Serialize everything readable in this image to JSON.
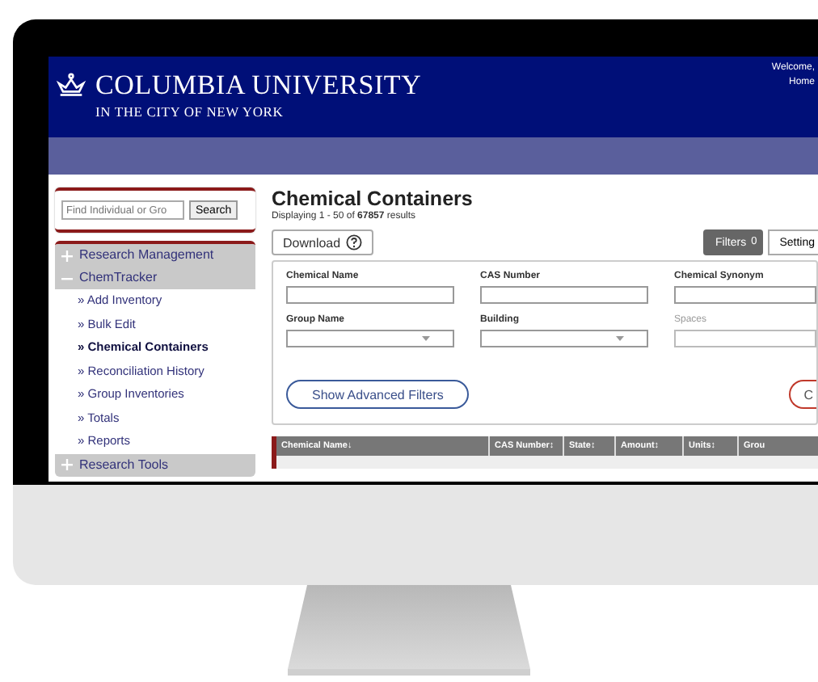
{
  "header": {
    "logo_title": "COLUMBIA UNIVERSITY",
    "logo_subtitle": "IN THE CITY OF NEW YORK",
    "welcome": "Welcome,",
    "home_link": "Home"
  },
  "sidebar": {
    "search": {
      "placeholder": "Find Individual or Gro",
      "button": "Search"
    },
    "menu": [
      {
        "label": "Research Management",
        "expanded": false
      },
      {
        "label": "ChemTracker",
        "expanded": true,
        "children": [
          {
            "label": "» Add Inventory",
            "selected": false
          },
          {
            "label": "» Bulk Edit",
            "selected": false
          },
          {
            "label": "» Chemical Containers",
            "selected": true
          },
          {
            "label": "» Reconciliation History",
            "selected": false
          },
          {
            "label": "» Group Inventories",
            "selected": false
          },
          {
            "label": "» Totals",
            "selected": false
          },
          {
            "label": "» Reports",
            "selected": false
          }
        ]
      },
      {
        "label": "Research Tools",
        "expanded": false
      }
    ]
  },
  "main": {
    "title": "Chemical Containers",
    "subtitle": "Displaying 1 - 50 of **67857** results",
    "download_button": "Download",
    "filters_button": "Filters",
    "filters_count": "0",
    "settings_button": "Setting",
    "filters": [
      {
        "label": "Chemical Name",
        "kind": "text",
        "disabled": false
      },
      {
        "label": "CAS Number",
        "kind": "text",
        "disabled": false
      },
      {
        "label": "Chemical Synonym",
        "kind": "text",
        "disabled": false
      },
      {
        "label": "Group Name",
        "kind": "select",
        "disabled": false
      },
      {
        "label": "Building",
        "kind": "select",
        "disabled": false
      },
      {
        "label": "Spaces",
        "kind": "text",
        "disabled": true
      }
    ],
    "advanced_button": "Show Advanced Filters",
    "clear_button": "C",
    "table": {
      "columns": [
        {
          "label": "Chemical Name",
          "sort": "↓"
        },
        {
          "label": "CAS Number",
          "sort": "↕"
        },
        {
          "label": "State",
          "sort": "↕"
        },
        {
          "label": "Amount",
          "sort": "↕"
        },
        {
          "label": "Units",
          "sort": "↕"
        },
        {
          "label": "Grou"
        }
      ]
    }
  }
}
